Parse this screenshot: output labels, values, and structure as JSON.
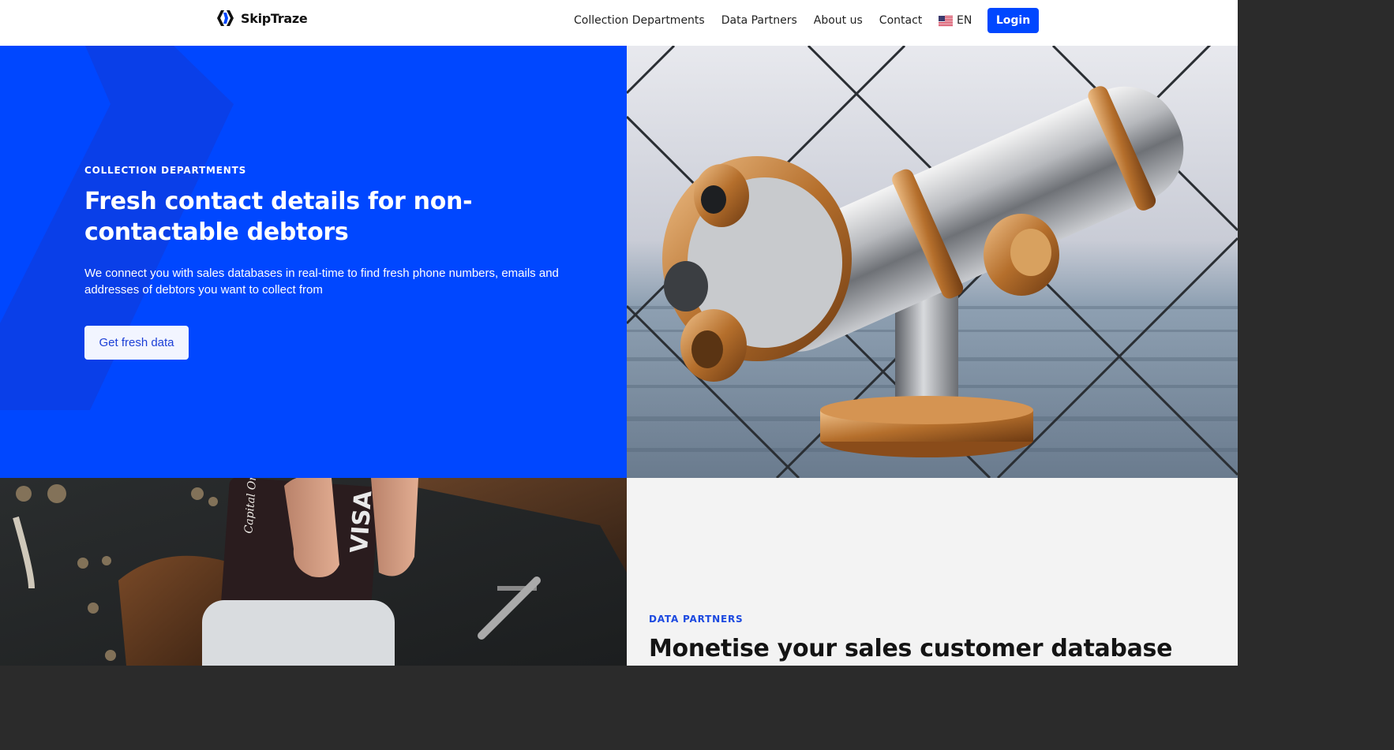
{
  "header": {
    "logo_text": "SkipTraze",
    "nav": [
      {
        "label": "Collection Departments"
      },
      {
        "label": "Data Partners"
      },
      {
        "label": "About us"
      },
      {
        "label": "Contact"
      }
    ],
    "language": "EN",
    "login_label": "Login"
  },
  "hero": {
    "eyebrow": "COLLECTION DEPARTMENTS",
    "title": "Fresh contact details for non-contactable debtors",
    "body": "We connect you with sales databases in real-time to find fresh phone numbers, emails and addresses of debtors you want to collect from",
    "cta_label": "Get fresh data"
  },
  "partners": {
    "eyebrow": "DATA PARTNERS",
    "title": "Monetise your sales customer database"
  },
  "card_image": {
    "brand_text": "Capital One",
    "network_text": "VISA"
  },
  "colors": {
    "brand_blue": "#0047ff",
    "accent_text_blue": "#1c49e0",
    "light_bg": "#f3f3f3"
  }
}
